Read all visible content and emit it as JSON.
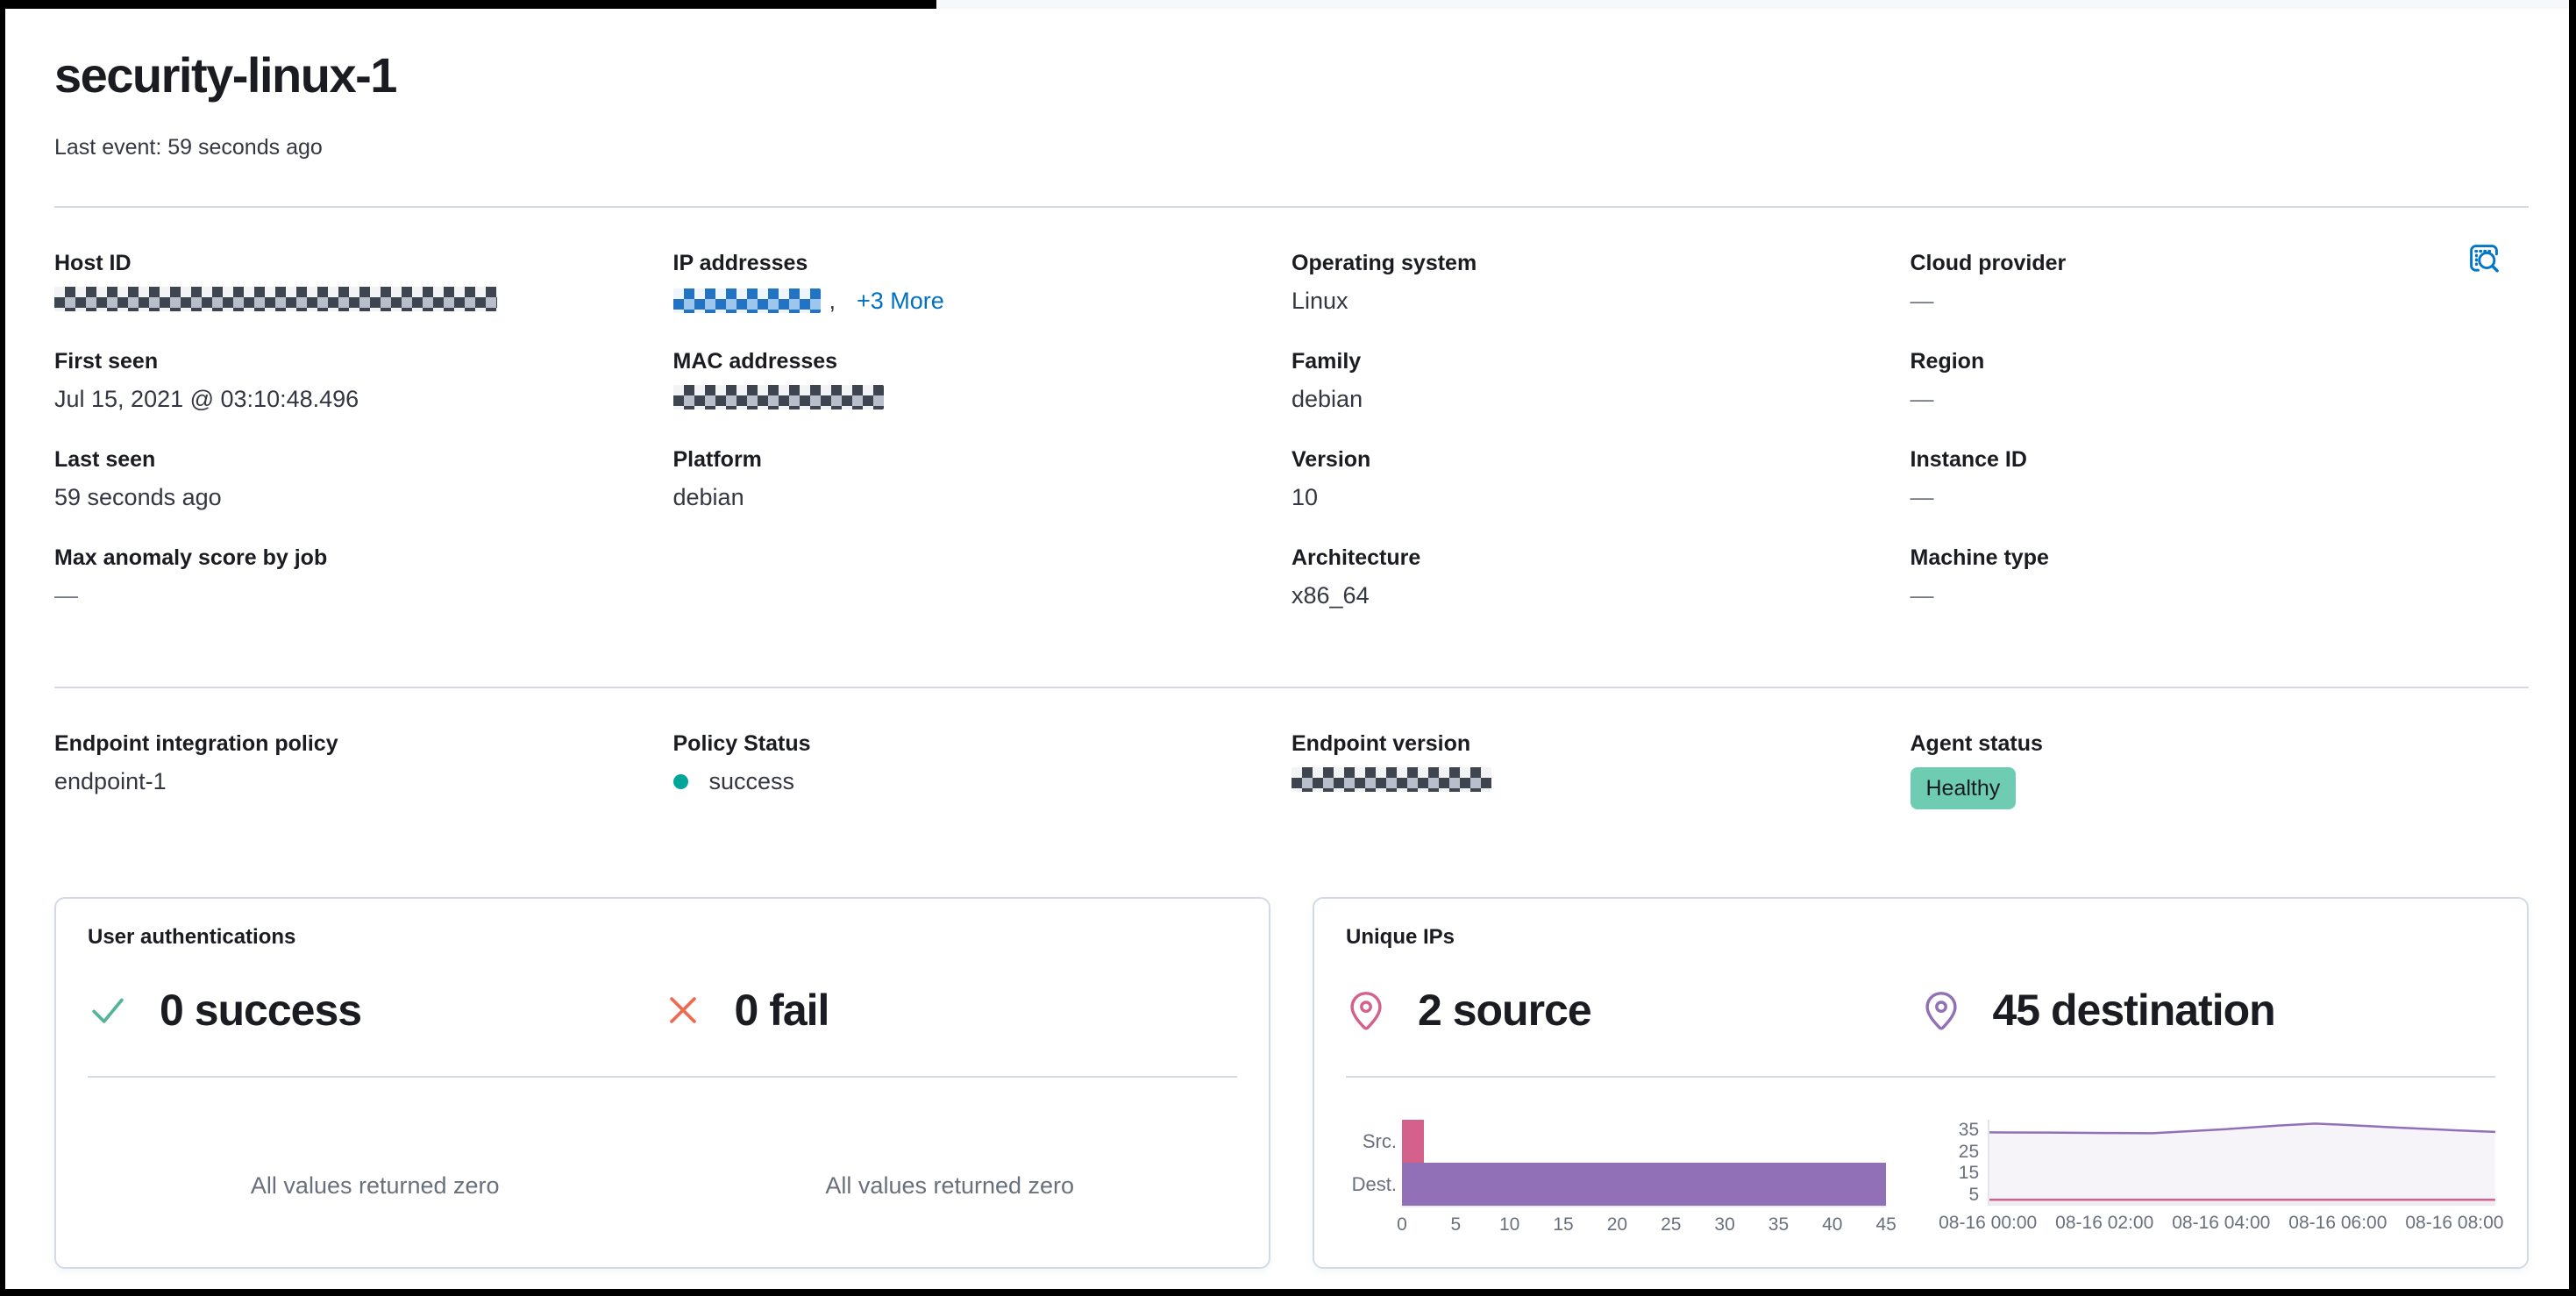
{
  "header": {
    "title": "security-linux-1",
    "last_event": "Last event: 59 seconds ago"
  },
  "overview": {
    "host_id_label": "Host ID",
    "host_id_redacted": true,
    "first_seen_label": "First seen",
    "first_seen_value": "Jul 15, 2021 @ 03:10:48.496",
    "last_seen_label": "Last seen",
    "last_seen_value": "59 seconds ago",
    "max_anomaly_label": "Max anomaly score by job",
    "max_anomaly_value": "—",
    "ip_label": "IP addresses",
    "ip_redacted": true,
    "ip_separator": ",",
    "ip_more_link": "+3 More",
    "mac_label": "MAC addresses",
    "mac_redacted": true,
    "platform_label": "Platform",
    "platform_value": "debian",
    "os_label": "Operating system",
    "os_value": "Linux",
    "family_label": "Family",
    "family_value": "debian",
    "version_label": "Version",
    "version_value": "10",
    "arch_label": "Architecture",
    "arch_value": "x86_64",
    "cloud_label": "Cloud provider",
    "cloud_value": "—",
    "region_label": "Region",
    "region_value": "—",
    "instance_label": "Instance ID",
    "instance_value": "—",
    "machine_label": "Machine type",
    "machine_value": "—"
  },
  "endpoint": {
    "policy_label": "Endpoint integration policy",
    "policy_value": "endpoint-1",
    "status_label": "Policy Status",
    "status_value": "success",
    "version_label": "Endpoint version",
    "version_redacted": true,
    "agent_label": "Agent status",
    "agent_value": "Healthy"
  },
  "auth_card": {
    "title": "User authentications",
    "success_stat": "0 success",
    "fail_stat": "0 fail",
    "success_empty": "All values returned zero",
    "fail_empty": "All values returned zero"
  },
  "ips_card": {
    "title": "Unique IPs",
    "source_stat": "2 source",
    "destination_stat": "45 destination",
    "chart_data": [
      {
        "type": "bar",
        "orientation": "horizontal",
        "title": "Unique IPs by direction",
        "categories": [
          "Src.",
          "Dest."
        ],
        "values": [
          2,
          45
        ],
        "colors": [
          "#d4608c",
          "#9170b8"
        ],
        "xlim": [
          0,
          45
        ],
        "xticks": [
          0,
          5,
          10,
          15,
          20,
          25,
          30,
          35,
          40,
          45
        ],
        "legend": "off",
        "grid": "off"
      },
      {
        "type": "area",
        "title": "Unique IPs over time",
        "x_labels": [
          "08-16 00:00",
          "08-16 02:00",
          "08-16 04:00",
          "08-16 06:00",
          "08-16 08:00"
        ],
        "x_hours": [
          0,
          2,
          4,
          6,
          8
        ],
        "x_range": [
          0,
          8.7
        ],
        "ylim": [
          0,
          40
        ],
        "yticks": [
          35,
          25,
          15,
          5
        ],
        "legend": "off",
        "grid": "off",
        "series": [
          {
            "name": "destination",
            "color": "#9170b8",
            "fill": "rgba(145,112,184,0.08)",
            "points": [
              [
                0,
                34
              ],
              [
                1,
                33.9
              ],
              [
                2,
                33.7
              ],
              [
                2.8,
                33.6
              ],
              [
                4,
                35.4
              ],
              [
                5,
                37.3
              ],
              [
                5.6,
                38.2
              ],
              [
                6,
                37.7
              ],
              [
                7,
                36.3
              ],
              [
                8,
                35
              ],
              [
                8.7,
                34.2
              ]
            ]
          },
          {
            "name": "source",
            "color": "#d4608c",
            "fill": "rgba(212,96,140,0.05)",
            "points": [
              [
                0,
                2
              ],
              [
                8.7,
                2
              ]
            ]
          }
        ]
      }
    ]
  },
  "icons": {
    "inspect": "inspect-icon (document with magnifier)",
    "success": "check-icon",
    "fail": "x-icon",
    "source": "map-pin-icon",
    "destination": "map-pin-icon"
  },
  "colors": {
    "link_blue": "#0071c2",
    "inspect_blue": "#0077cc",
    "success_green": "#54b399",
    "danger_coral": "#ec6b51",
    "source_pink": "#d4608c",
    "destination_purple": "#9170b8",
    "healthy_badge": "#6dccb1",
    "status_dot": "#00a69a",
    "divider": "#d3dae6"
  }
}
